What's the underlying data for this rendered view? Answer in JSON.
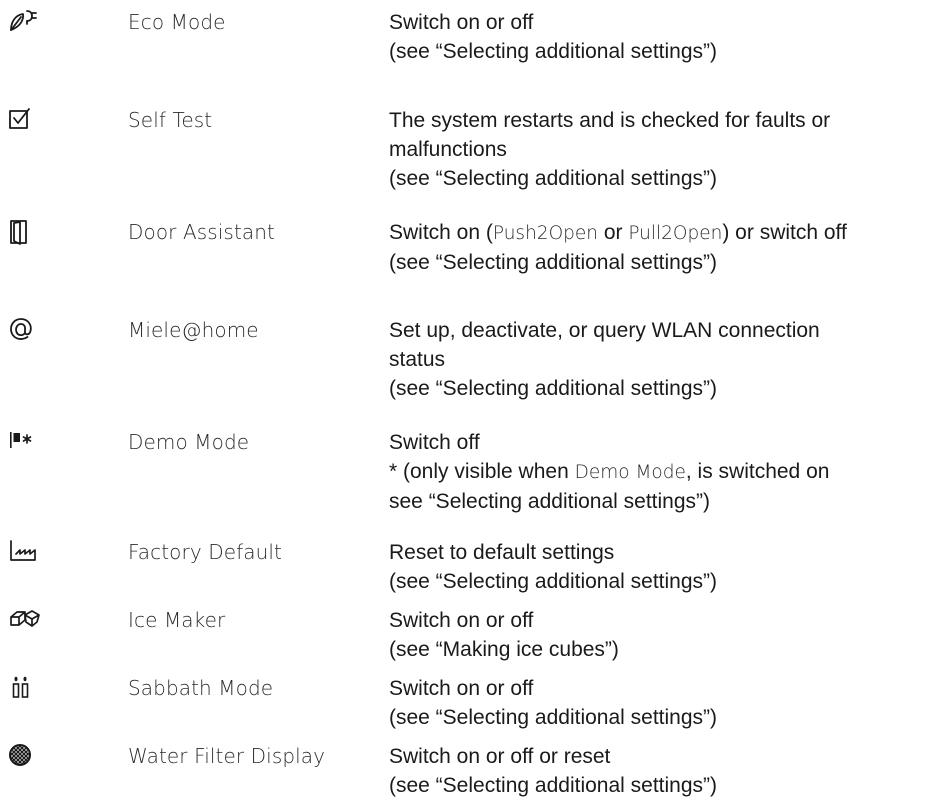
{
  "settings": [
    {
      "icon": "eco-leaf-plug-icon",
      "name": "Eco Mode",
      "lines": [
        "Switch on or off",
        "(see “Selecting additional settings”)"
      ]
    },
    {
      "icon": "checkbox-check-icon",
      "name": "Self Test",
      "lines": [
        "The system restarts and is checked for faults or",
        "malfunctions",
        "(see “Selecting additional settings”)"
      ]
    },
    {
      "icon": "door-icon",
      "name": "Door Assistant",
      "line1": {
        "a": "Switch on (",
        "b": "Push2Open",
        "c": " or ",
        "d": "Pull2Open",
        "e": ") or switch off"
      },
      "lines": [
        "(see “Selecting additional settings”)"
      ]
    },
    {
      "icon": "at-sign-icon",
      "name": "Miele@home",
      "lines": [
        "Set up, deactivate, or query WLAN connection",
        "status",
        "(see “Selecting additional settings”)"
      ]
    },
    {
      "icon": "demo-flag-asterisk-icon",
      "name": "Demo Mode",
      "lines": [
        "Switch off"
      ],
      "line2": {
        "a": "* (only visible when ",
        "b": "Demo Mode",
        "c": ", is switched on"
      },
      "line3": "see “Selecting additional settings”)"
    },
    {
      "icon": "factory-icon",
      "name": "Factory Default",
      "lines": [
        "Reset to default settings",
        "(see “Selecting additional settings”)"
      ]
    },
    {
      "icon": "ice-cubes-icon",
      "name": "Ice Maker",
      "lines": [
        "Switch on or off",
        "(see “Making ice cubes”)"
      ]
    },
    {
      "icon": "sabbath-candles-icon",
      "name": "Sabbath Mode",
      "lines": [
        "Switch on or off",
        "(see “Selecting additional settings”)"
      ]
    },
    {
      "icon": "water-filter-icon",
      "name": "Water Filter Display",
      "lines": [
        "Switch on or off or reset",
        "(see “Selecting additional settings”)"
      ]
    }
  ]
}
